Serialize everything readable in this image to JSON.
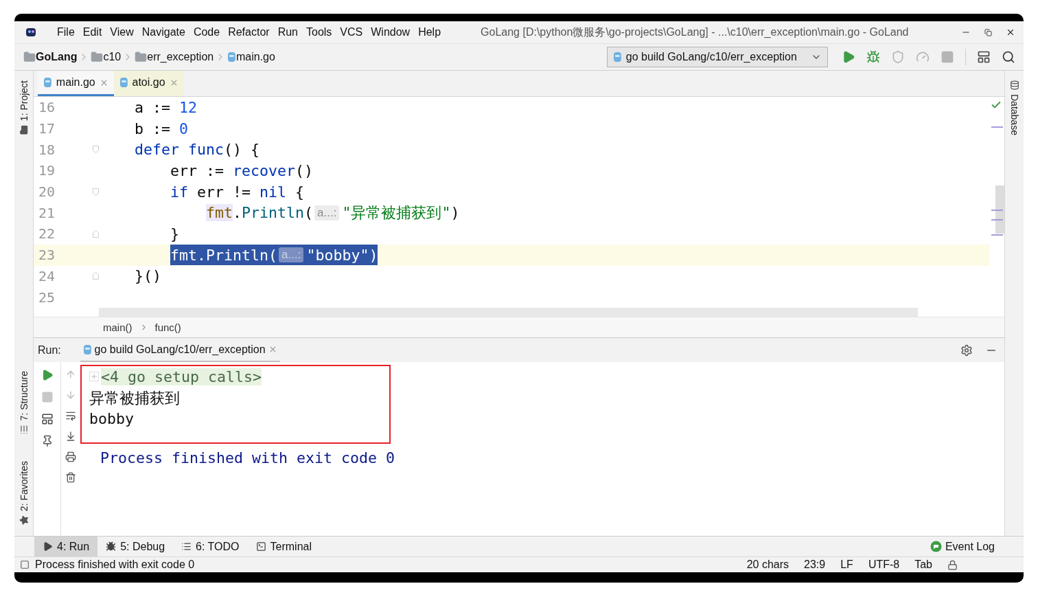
{
  "window": {
    "title": "GoLang [D:\\python微服务\\go-projects\\GoLang] - ...\\c10\\err_exception\\main.go - GoLand",
    "controls": [
      {
        "kind": "minimize"
      },
      {
        "kind": "restore"
      },
      {
        "kind": "close"
      }
    ]
  },
  "menu": [
    {
      "label": "File"
    },
    {
      "label": "Edit"
    },
    {
      "label": "View"
    },
    {
      "label": "Navigate"
    },
    {
      "label": "Code"
    },
    {
      "label": "Refactor"
    },
    {
      "label": "Run"
    },
    {
      "label": "Tools"
    },
    {
      "label": "VCS"
    },
    {
      "label": "Window"
    },
    {
      "label": "Help"
    }
  ],
  "breadcrumbs": [
    {
      "label": "GoLang",
      "kind": "project"
    },
    {
      "label": "c10",
      "kind": "folder"
    },
    {
      "label": "err_exception",
      "kind": "folder"
    },
    {
      "label": "main.go",
      "kind": "go_file"
    }
  ],
  "run_config": {
    "label": "go build GoLang/c10/err_exception"
  },
  "toolbar": [
    {
      "kind": "run",
      "disabled": false
    },
    {
      "kind": "debug",
      "disabled": false
    },
    {
      "kind": "coverage",
      "disabled": true
    },
    {
      "kind": "profile",
      "disabled": true
    },
    {
      "kind": "stop",
      "disabled": true
    },
    {
      "kind": "terminal",
      "disabled": false
    },
    {
      "kind": "search",
      "disabled": false
    }
  ],
  "left_tools_top": [
    {
      "label": "1: Project",
      "kind": "project"
    }
  ],
  "left_tools_bottom": [
    {
      "label": "7: Structure",
      "kind": "structure"
    },
    {
      "label": "2: Favorites",
      "kind": "favorites"
    }
  ],
  "right_tools": [
    {
      "label": "Database"
    }
  ],
  "editor_tabs": [
    {
      "label": "main.go",
      "selected": true
    },
    {
      "label": "atoi.go",
      "selected": false
    }
  ],
  "editor": {
    "lines": [
      {
        "number": "16",
        "kind": "plain",
        "current": false,
        "selected": false,
        "tokens": [
          {
            "text": "    a := ",
            "kind": "plain"
          },
          {
            "text": "12",
            "kind": "number"
          }
        ]
      },
      {
        "number": "17",
        "kind": "plain",
        "current": false,
        "selected": false,
        "tokens": [
          {
            "text": "    b := ",
            "kind": "plain"
          },
          {
            "text": "0",
            "kind": "number"
          }
        ]
      },
      {
        "number": "18",
        "kind": "fold_start",
        "current": false,
        "selected": false,
        "tokens": [
          {
            "text": "    defer func",
            "kind": "keyword"
          },
          {
            "text": "() {",
            "kind": "plain"
          }
        ]
      },
      {
        "number": "19",
        "kind": "plain",
        "current": false,
        "selected": false,
        "tokens": [
          {
            "text": "        err := ",
            "kind": "plain"
          },
          {
            "text": "recover",
            "kind": "builtin"
          },
          {
            "text": "()",
            "kind": "plain"
          }
        ]
      },
      {
        "number": "20",
        "kind": "fold_start",
        "current": false,
        "selected": false,
        "tokens": [
          {
            "text": "        if",
            "kind": "keyword"
          },
          {
            "text": " err != ",
            "kind": "plain"
          },
          {
            "text": "nil",
            "kind": "keyword"
          },
          {
            "text": " {",
            "kind": "plain"
          }
        ]
      },
      {
        "number": "21",
        "kind": "plain",
        "current": false,
        "selected": false,
        "tokens": [
          {
            "text": "            fmt",
            "kind": "package_usage"
          },
          {
            "text": ".",
            "kind": "plain"
          },
          {
            "text": "Println",
            "kind": "call"
          },
          {
            "text": "(",
            "kind": "plain"
          },
          {
            "text": "a...:",
            "kind": "hint"
          },
          {
            "text": "\"异常被捕获到\"",
            "kind": "string"
          },
          {
            "text": ")",
            "kind": "plain"
          }
        ]
      },
      {
        "number": "22",
        "kind": "fold_end",
        "current": false,
        "selected": false,
        "tokens": [
          {
            "text": "        }",
            "kind": "plain"
          }
        ]
      },
      {
        "number": "23",
        "kind": "plain",
        "current": true,
        "selected": true,
        "tokens": [
          {
            "text": "        fmt",
            "kind": "package"
          },
          {
            "text": ".",
            "kind": "plain"
          },
          {
            "text": "Println",
            "kind": "call"
          },
          {
            "text": "(",
            "kind": "plain"
          },
          {
            "text": "a...:",
            "kind": "hint"
          },
          {
            "text": "\"bobby\"",
            "kind": "string"
          },
          {
            "text": ")",
            "kind": "plain"
          }
        ]
      },
      {
        "number": "24",
        "kind": "fold_end",
        "current": false,
        "selected": false,
        "tokens": [
          {
            "text": "    }()",
            "kind": "plain"
          }
        ]
      },
      {
        "number": "25",
        "kind": "plain",
        "current": false,
        "selected": false
      }
    ]
  },
  "code_path": [
    {
      "label": "main()"
    },
    {
      "label": "func()"
    }
  ],
  "run_panel": {
    "label": "Run:",
    "tab": "go build GoLang/c10/err_exception",
    "output": [
      {
        "text": "<4 go setup calls>",
        "kind": "folded",
        "marked": true
      },
      {
        "text": "异常被捕获到",
        "kind": "stdout",
        "marked": true
      },
      {
        "text": "bobby",
        "kind": "stdout",
        "marked": true
      },
      {
        "text": "Process finished with exit code 0",
        "kind": "system",
        "marked": false
      }
    ]
  },
  "bottom_tabs": [
    {
      "label": "4: Run",
      "kind": "run",
      "selected": true
    },
    {
      "label": "5: Debug",
      "kind": "debug",
      "selected": false
    },
    {
      "label": "6: TODO",
      "kind": "todo",
      "selected": false
    },
    {
      "label": "Terminal",
      "kind": "terminal",
      "selected": false
    }
  ],
  "event_log": {
    "label": "Event Log"
  },
  "status_bar": {
    "message": "Process finished with exit code 0",
    "items": [
      {
        "text": "20 chars"
      },
      {
        "text": "23:9"
      },
      {
        "text": "LF"
      },
      {
        "text": "UTF-8"
      },
      {
        "text": "Tab"
      }
    ]
  }
}
